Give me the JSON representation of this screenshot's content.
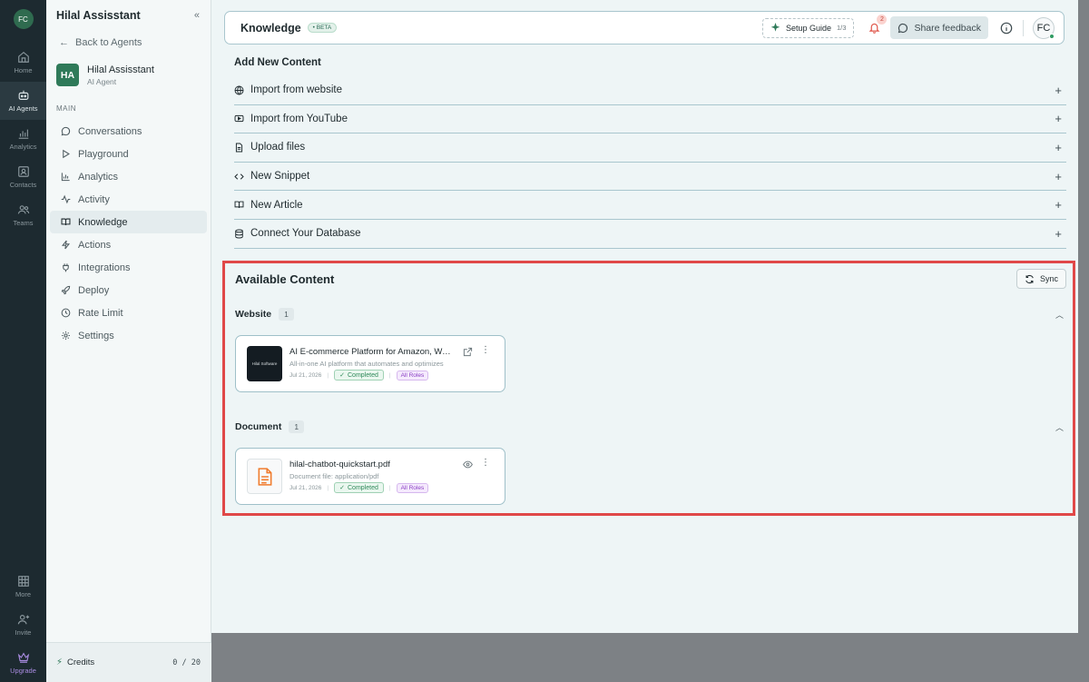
{
  "rail": {
    "avatar": "FC",
    "items": [
      {
        "label": "Home",
        "icon": "home-icon"
      },
      {
        "label": "AI Agents",
        "icon": "robot-icon"
      },
      {
        "label": "Analytics",
        "icon": "bar-chart-icon"
      },
      {
        "label": "Contacts",
        "icon": "contact-card-icon"
      },
      {
        "label": "Teams",
        "icon": "users-icon"
      }
    ],
    "bottom": [
      {
        "label": "More",
        "icon": "grid-icon"
      },
      {
        "label": "Invite",
        "icon": "user-plus-icon"
      },
      {
        "label": "Upgrade",
        "icon": "crown-icon"
      }
    ]
  },
  "sidebar": {
    "title": "Hilal Assisstant",
    "back": "Back to Agents",
    "agent": {
      "initials": "HA",
      "name": "Hilal Assisstant",
      "role": "AI Agent"
    },
    "section": "MAIN",
    "items": [
      {
        "label": "Conversations"
      },
      {
        "label": "Playground"
      },
      {
        "label": "Analytics"
      },
      {
        "label": "Activity"
      },
      {
        "label": "Knowledge"
      },
      {
        "label": "Actions"
      },
      {
        "label": "Integrations"
      },
      {
        "label": "Deploy"
      },
      {
        "label": "Rate Limit"
      },
      {
        "label": "Settings"
      }
    ],
    "credits": {
      "label": "Credits",
      "value": "0 / 20"
    }
  },
  "topbar": {
    "title": "Knowledge",
    "beta": "BETA",
    "setup": {
      "label": "Setup Guide",
      "count": "1/3"
    },
    "notifications": "2",
    "feedback": "Share feedback",
    "avatar": "FC"
  },
  "add_content": {
    "title": "Add New Content",
    "items": [
      {
        "label": "Import from website"
      },
      {
        "label": "Import from YouTube"
      },
      {
        "label": "Upload files"
      },
      {
        "label": "New Snippet"
      },
      {
        "label": "New Article"
      },
      {
        "label": "Connect Your Database"
      }
    ]
  },
  "available": {
    "title": "Available Content",
    "sync": "Sync",
    "website": {
      "label": "Website",
      "count": "1",
      "card": {
        "thumb": "Hilal Software",
        "title": "AI E-commerce Platform for Amazon, Walmart & More",
        "desc": "All-in-one AI platform that automates and optimizes",
        "date": "Jul 21, 2026",
        "status": "Completed",
        "roles": "All Roles"
      }
    },
    "document": {
      "label": "Document",
      "count": "1",
      "card": {
        "title": "hilal-chatbot-quickstart.pdf",
        "desc": "Document file: application/pdf",
        "date": "Jul 21, 2026",
        "status": "Completed",
        "roles": "All Roles"
      }
    }
  },
  "colors": {
    "rail": "#1d2a30",
    "accent": "#2f7a59",
    "highlight": "#e04848",
    "status_green": "#2f8a5a",
    "roles_purple": "#8a3fc4"
  }
}
